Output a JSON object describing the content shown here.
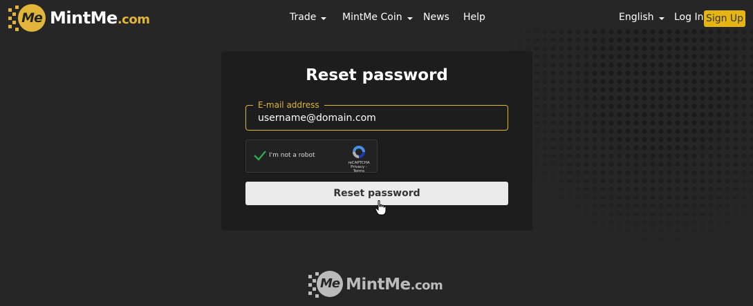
{
  "brand": {
    "name": "MintMe",
    "domain": ".com",
    "mark": "Me",
    "accent": "#e1b53a"
  },
  "nav": {
    "items": [
      {
        "label": "Trade",
        "dropdown": true
      },
      {
        "label": "MintMe Coin",
        "dropdown": true
      },
      {
        "label": "News",
        "dropdown": false
      },
      {
        "label": "Help",
        "dropdown": false
      }
    ],
    "language": "English",
    "login": "Log In",
    "signup": "Sign Up"
  },
  "form": {
    "title": "Reset password",
    "email_label": "E-mail address",
    "email_value": "username@domain.com",
    "recaptcha_label": "I'm not a robot",
    "recaptcha_brand": "reCAPTCHA",
    "recaptcha_links": "Privacy - Terms",
    "submit": "Reset password"
  },
  "footer": {
    "name": "MintMe",
    "domain": ".com",
    "mark": "Me"
  }
}
